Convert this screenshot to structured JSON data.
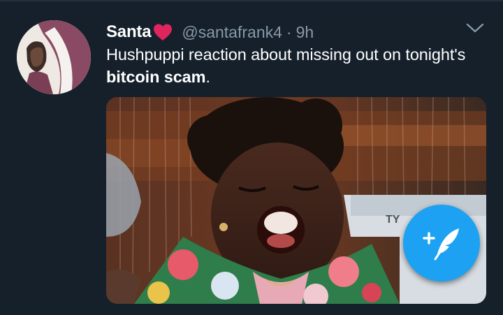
{
  "tweet": {
    "display_name": "Santa",
    "handle": "@santafrank4",
    "separator": "·",
    "time": "9h",
    "text_before": "Hushpuppi reaction about missing out on tonight's ",
    "text_bold": "bitcoin scam",
    "text_after": ".",
    "name_emoji": "heart-icon",
    "menu_icon": "chevron-down-icon"
  },
  "media": {
    "machine_text": "TY"
  },
  "compose_fab": {
    "icon": "feather-plus-icon",
    "color": "#1da1f2"
  },
  "colors": {
    "background": "#15202b",
    "secondary_text": "#8899a6",
    "heart": "#e0245e"
  }
}
